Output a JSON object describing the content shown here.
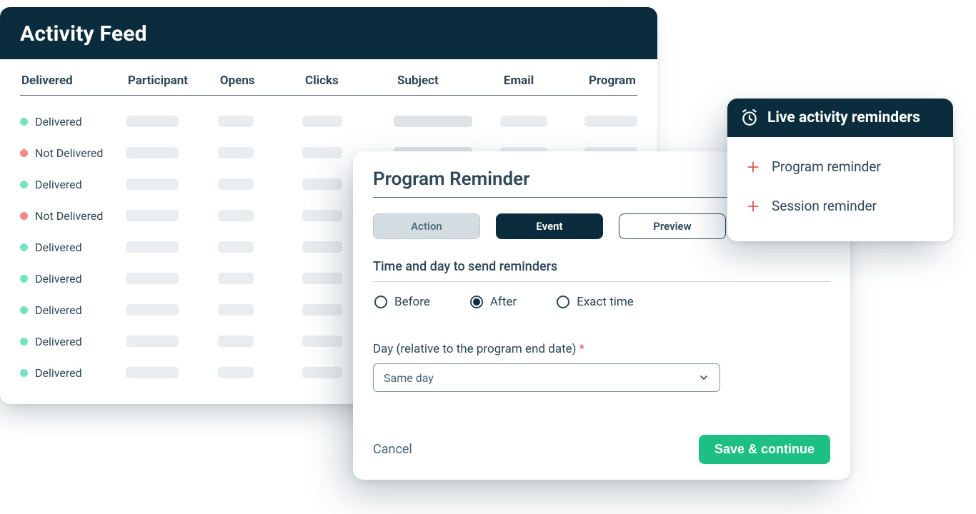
{
  "feed": {
    "title": "Activity Feed",
    "columns": {
      "delivered": "Delivered",
      "participant": "Participant",
      "opens": "Opens",
      "clicks": "Clicks",
      "subject": "Subject",
      "email": "Email",
      "program": "Program"
    },
    "status_labels": {
      "delivered": "Delivered",
      "not_delivered": "Not Delivered"
    },
    "rows": [
      {
        "status": "delivered"
      },
      {
        "status": "not_delivered"
      },
      {
        "status": "delivered"
      },
      {
        "status": "not_delivered"
      },
      {
        "status": "delivered"
      },
      {
        "status": "delivered"
      },
      {
        "status": "delivered"
      },
      {
        "status": "delivered"
      },
      {
        "status": "delivered"
      }
    ]
  },
  "editor": {
    "title": "Program Reminder",
    "tabs": {
      "action": "Action",
      "event": "Event",
      "preview": "Preview",
      "active": "event"
    },
    "section_label": "Time and day to send reminders",
    "radios": {
      "before": "Before",
      "after": "After",
      "exact": "Exact time",
      "selected": "after"
    },
    "day_field": {
      "label": "Day (relative to the program end date)",
      "required_mark": "*",
      "value": "Same day"
    },
    "actions": {
      "cancel": "Cancel",
      "save": "Save & continue"
    }
  },
  "reminders": {
    "title": "Live activity reminders",
    "items": [
      {
        "label": "Program reminder"
      },
      {
        "label": "Session reminder"
      }
    ]
  }
}
